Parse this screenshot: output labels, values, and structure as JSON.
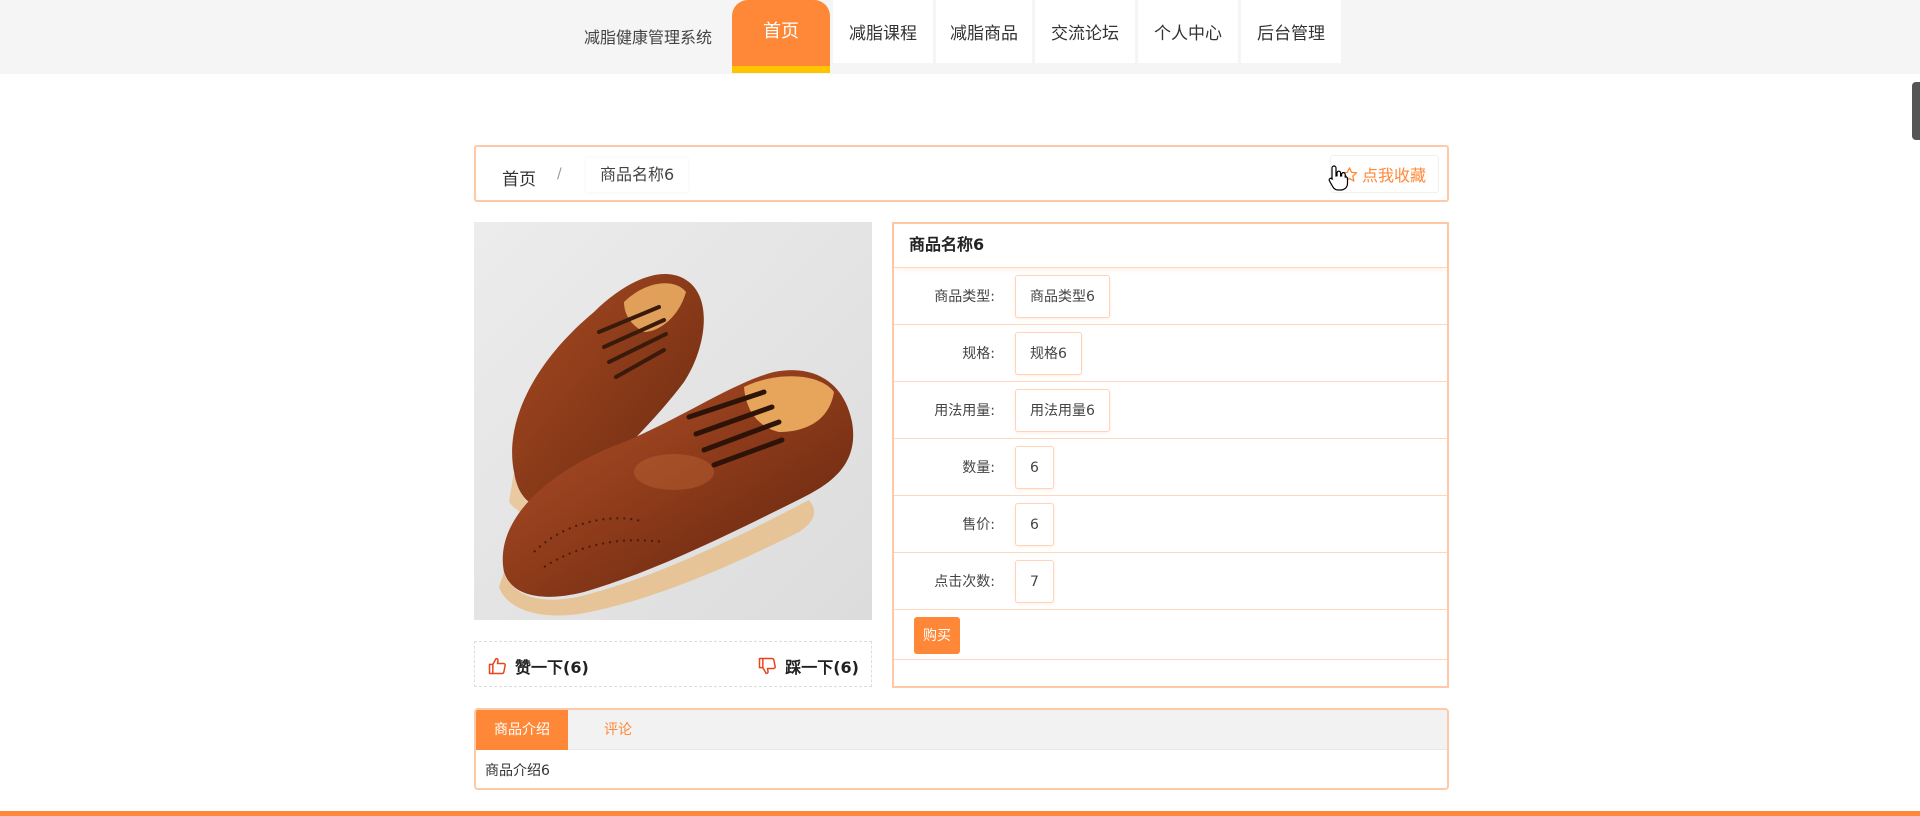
{
  "site": {
    "name": "减脂健康管理系统"
  },
  "nav": {
    "items": [
      {
        "label": "首页",
        "active": true
      },
      {
        "label": "减脂课程"
      },
      {
        "label": "减脂商品"
      },
      {
        "label": "交流论坛"
      },
      {
        "label": "个人中心"
      },
      {
        "label": "后台管理"
      }
    ]
  },
  "breadcrumb": {
    "home": "首页",
    "separator": "/",
    "current": "商品名称6"
  },
  "favorite": {
    "label": "点我收藏",
    "icon": "star-icon"
  },
  "vote": {
    "up": {
      "label": "赞一下(6)",
      "icon": "thumbs-up-icon"
    },
    "down": {
      "label": "踩一下(6)",
      "icon": "thumbs-down-icon"
    }
  },
  "detail": {
    "title": "商品名称6",
    "rows": [
      {
        "label": "商品类型:",
        "value": "商品类型6"
      },
      {
        "label": "规格:",
        "value": "规格6"
      },
      {
        "label": "用法用量:",
        "value": "用法用量6"
      },
      {
        "label": "数量:",
        "value": "6"
      },
      {
        "label": "售价:",
        "value": "6"
      },
      {
        "label": "点击次数:",
        "value": "7"
      }
    ],
    "buy_label": "购买"
  },
  "tabs": {
    "items": [
      {
        "label": "商品介绍",
        "active": true
      },
      {
        "label": "评论"
      }
    ],
    "content": "商品介绍6"
  },
  "colors": {
    "accent": "#ff8838",
    "accent_underline": "#ffc400",
    "border": "#ffc8a6"
  }
}
